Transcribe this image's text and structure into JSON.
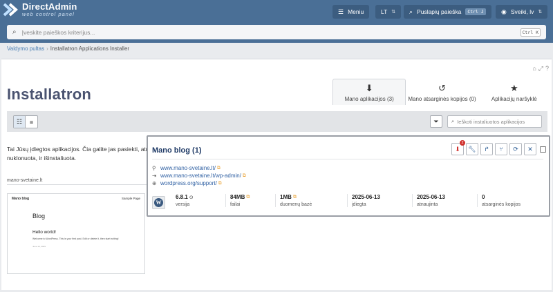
{
  "brand": {
    "title": "DirectAdmin",
    "subtitle": "web control panel"
  },
  "topbar": {
    "menu_label": "Meniu",
    "lang_label": "LT",
    "page_search_label": "Puslapių paieška",
    "page_search_shortcut": "Ctrl J",
    "user_label": "Sveiki, lv"
  },
  "search": {
    "placeholder": "Įveskite paieškos kriterijus...",
    "shortcut": "Ctrl K"
  },
  "breadcrumb": {
    "home": "Valdymo pultas",
    "current": "Installatron Applications Installer"
  },
  "installatron": {
    "logo_text": "Installatron"
  },
  "tabs": [
    {
      "label": "Mano aplikacijos (3)",
      "icon": "download-circle-icon"
    },
    {
      "label": "Mano atsarginės kopijos (0)",
      "icon": "history-icon"
    },
    {
      "label": "Aplikacijų naršyklė",
      "icon": "star-icon"
    }
  ],
  "toolbar": {
    "search_placeholder": "Ieškoti instaliuotos aplikacijos"
  },
  "description": "Tai Jūsų įdiegtos aplikacijos. Čia galite jas pasiekti, atnaujinti, padaryti atsargines kopijas, redaguoti bei pašalinti. Aplikacijos gali būti paskutinį kartą prieinama, atnaujinta, redaguota, sukurta atsarginė kopija, nuklonuota, ir išinstaliuota.",
  "domain_label": "mano-svetaine.lt",
  "preview": {
    "site_name": "Mano blog",
    "nav": "Sample Page",
    "heading": "Blog",
    "post_title": "Hello world!",
    "post_text": "Welcome to WordPress. This is your first post. Edit or delete it, then start writing!",
    "post_date": "June 13, 2025"
  },
  "app": {
    "title": "Mano blog (1)",
    "update_badge": "2",
    "links": [
      {
        "icon": "location-pin-icon",
        "text": "www.mano-svetaine.lt/"
      },
      {
        "icon": "login-icon",
        "text": "www.mano-svetaine.lt/wp-admin/"
      },
      {
        "icon": "globe-icon",
        "text": "wordpress.org/support/"
      }
    ],
    "stats": [
      {
        "value": "6.8.1",
        "label": "versija"
      },
      {
        "value": "84MB",
        "label": "failai"
      },
      {
        "value": "1MB",
        "label": "duomenų bazė"
      },
      {
        "value": "2025-06-13",
        "label": "įdiegta"
      },
      {
        "value": "2025-06-13",
        "label": "atnaujinta"
      },
      {
        "value": "0",
        "label": "atsarginės kopijos"
      }
    ]
  },
  "colors": {
    "topbar": "#4a6f96",
    "link": "#2e5fa2",
    "danger": "#d0312d",
    "title": "#1f3a66"
  }
}
